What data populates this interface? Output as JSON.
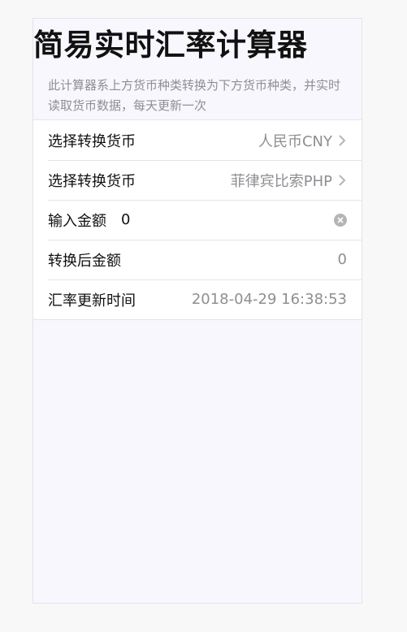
{
  "page": {
    "title": "简易实时汇率计算器",
    "description": "此计算器系上方货币种类转换为下方货币种类，并实时读取货币数据，每天更新一次"
  },
  "rows": {
    "from_currency": {
      "label": "选择转换货币",
      "value": "人民币CNY"
    },
    "to_currency": {
      "label": "选择转换货币",
      "value": "菲律宾比索PHP"
    },
    "amount": {
      "label": "输入金额",
      "value": "0"
    },
    "converted": {
      "label": "转换后金额",
      "value": "0"
    },
    "updated": {
      "label": "汇率更新时间",
      "value": "2018-04-29 16:38:53"
    }
  },
  "icons": {
    "chevron": "chevron-right-icon",
    "clear": "clear-icon"
  },
  "colors": {
    "accent_gray": "#8e8e93",
    "clear_icon": "#b5b5b5"
  }
}
